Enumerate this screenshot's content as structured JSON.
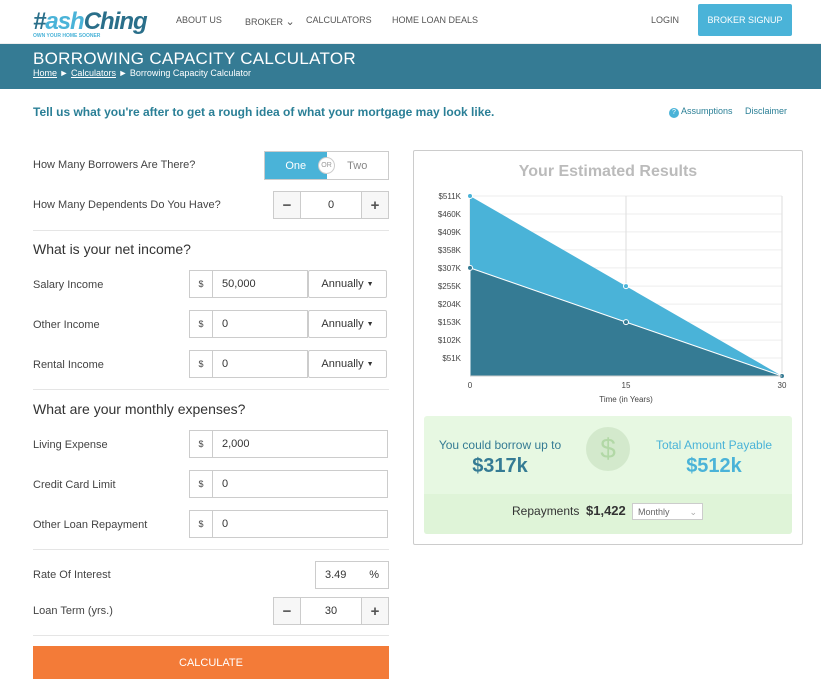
{
  "nav": {
    "logo": "HashChing",
    "logo_tag": "OWN YOUR HOME SOONER",
    "items": [
      "ABOUT US",
      "BROKER",
      "CALCULATORS",
      "HOME LOAN DEALS"
    ],
    "login": "LOGIN",
    "signup": "BROKER SIGNUP"
  },
  "banner": {
    "title": "BORROWING CAPACITY CALCULATOR",
    "breadcrumb": [
      "Home",
      "Calculators",
      "Borrowing Capacity Calculator"
    ]
  },
  "intro": "Tell us what you're after to get a rough idea of what your mortgage may look like.",
  "links": {
    "assumptions": "Assumptions",
    "disclaimer": "Disclaimer"
  },
  "form": {
    "borrowers_label": "How Many Borrowers Are There?",
    "borrowers_options": [
      "One",
      "Two"
    ],
    "or": "OR",
    "borrowers_selected": "One",
    "dependents_label": "How Many Dependents Do You Have?",
    "dependents": "0",
    "income_heading": "What is your net income?",
    "income": [
      {
        "label": "Salary Income",
        "value": "50,000",
        "freq": "Annually"
      },
      {
        "label": "Other Income",
        "value": "0",
        "freq": "Annually"
      },
      {
        "label": "Rental Income",
        "value": "0",
        "freq": "Annually"
      }
    ],
    "expenses_heading": "What are your monthly expenses?",
    "expenses": [
      {
        "label": "Living Expense",
        "value": "2,000"
      },
      {
        "label": "Credit Card Limit",
        "value": "0"
      },
      {
        "label": "Other Loan Repayment",
        "value": "0"
      }
    ],
    "currency": "$",
    "rate_label": "Rate Of Interest",
    "rate": "3.49",
    "percent": "%",
    "term_label": "Loan Term (yrs.)",
    "term": "30",
    "calculate": "CALCULATE"
  },
  "results": {
    "title": "Your Estimated Results",
    "borrow_label": "You could borrow up to",
    "borrow": "$317k",
    "payable_label": "Total Amount Payable",
    "payable": "$512k",
    "repay_label": "Repayments",
    "repay": "$1,422",
    "repay_freq": "Monthly",
    "colors": {
      "payable": "#4ab3d8",
      "borrow": "#357b94"
    }
  },
  "chart_data": {
    "type": "area",
    "x": [
      0,
      15,
      30
    ],
    "xlabel": "Time (in Years)",
    "x_ticks": [
      "0",
      "15",
      "30"
    ],
    "y_ticks": [
      "$51K",
      "$102K",
      "$153K",
      "$204K",
      "$255K",
      "$307K",
      "$358K",
      "$409K",
      "$460K",
      "$511K"
    ],
    "ylim": [
      0,
      511
    ],
    "series": [
      {
        "values": [
          511,
          255,
          0
        ],
        "color": "#4ab3d8"
      },
      {
        "values": [
          307,
          153,
          0
        ],
        "color": "#357b94"
      }
    ],
    "grid": true
  }
}
